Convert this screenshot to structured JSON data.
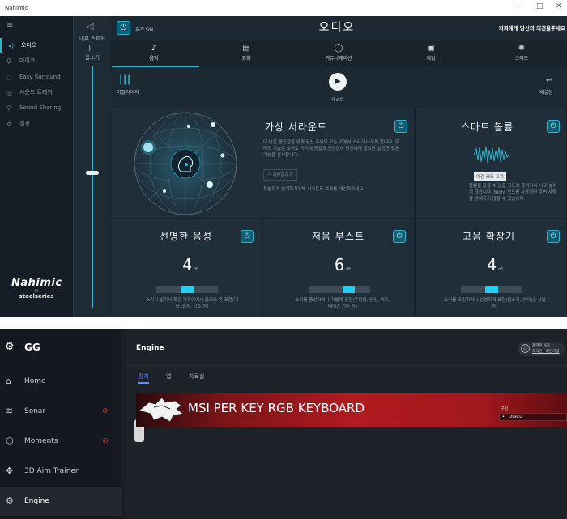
{
  "nahimic": {
    "window_title": "Nahimic",
    "window_controls": [
      "—",
      "□",
      "✕"
    ],
    "sidebar": {
      "items": [
        {
          "label": "오디오",
          "icon": "speaker-icon"
        },
        {
          "label": "마이크",
          "icon": "mic-icon"
        },
        {
          "label": "Easy Surround",
          "icon": "surround-icon"
        },
        {
          "label": "사운드 트래커",
          "icon": "tracker-icon"
        },
        {
          "label": "Sound Sharing",
          "icon": "share-icon"
        },
        {
          "label": "설정",
          "icon": "gear-icon"
        }
      ],
      "logo_brand": "Nahimic",
      "logo_by": "BY",
      "logo_partner": "steelseries"
    },
    "volume": {
      "device_label": "내부 스피커",
      "volume_label": "음소거",
      "level": 0.56
    },
    "header": {
      "effect_label": "효과 ON",
      "title": "오디오",
      "feedback_link": "저희에게 당신의 의견을주세요"
    },
    "tabs": [
      {
        "label": "음악",
        "icon": "music-note-icon",
        "active": true
      },
      {
        "label": "영화",
        "icon": "clapper-icon",
        "active": false
      },
      {
        "label": "커뮤니케이션",
        "icon": "chat-icon",
        "active": false
      },
      {
        "label": "게임",
        "icon": "gamepad-icon",
        "active": false
      },
      {
        "label": "스마트",
        "icon": "smart-icon",
        "active": false
      }
    ],
    "toolbar": {
      "equalizer_label": "이퀄라이저",
      "test_label": "테스트",
      "reset_label": "재설정"
    },
    "panels": {
      "virtual_surround": {
        "title": "가상 서라운드",
        "description": "더 나은 몰입감을 위해 당신 주위의 모든 곳에서 소리가 나도록 합니다. 우리의 기술은 오디오 기기에 동일과 신관없이 당신에게 필요한 설정한 모든 기능을 선사합니다.",
        "personalize_label": "개인화하기",
        "note": "특별하게 설계하기위해 서라운드 효과를 개인화하세요"
      },
      "smart_volume": {
        "title": "스마트 볼륨",
        "mode_label": "야간 모드 끄기",
        "description": "볼륨을 들을 수 없을 정도로 줄이거나 너무 높여지 않습니다. Night 모드를 사용하면 주변 사람을 방해하지 않을 수 있습니다."
      },
      "voice_clarity": {
        "title": "선명한 음성",
        "value": "4",
        "unit": "dB",
        "level": 0.5,
        "description": "소리가 빌리서 혹은 가까이에서 들려도 목 표현(대화, 협정, 답소 등)"
      },
      "bass_boost": {
        "title": "저음 부스트",
        "value": "6",
        "unit": "dB",
        "level": 0.65,
        "description": "소리를 풍성하거나 가볍게 표현(우렁음, 엔진, 비트, 베이스 기타 등)"
      },
      "treble_boost": {
        "title": "고음 확장기",
        "value": "4",
        "unit": "dB",
        "level": 0.5,
        "description": "소리를 조밀하거나 선명하게 표현(발소리, 위타닝, 심벌 등)"
      }
    }
  },
  "gg": {
    "app_title": "GG",
    "sidebar": {
      "items": [
        {
          "label": "Home",
          "icon": "home-icon",
          "active": false,
          "disabled_icon": ""
        },
        {
          "label": "Sonar",
          "icon": "sonar-icon",
          "active": false,
          "disabled_icon": "headset-off-icon"
        },
        {
          "label": "Moments",
          "icon": "moments-icon",
          "active": false,
          "disabled_icon": "capture-off-icon"
        },
        {
          "label": "3D Aim Trainer",
          "icon": "crosshair-icon",
          "active": false,
          "disabled_icon": ""
        },
        {
          "label": "Engine",
          "icon": "gear-icon",
          "active": true,
          "disabled_icon": ""
        }
      ]
    },
    "header": {
      "title": "Engine",
      "user_name": "제한된 사용",
      "user_link": "로그인 | 회원가입"
    },
    "tabs": [
      {
        "label": "장치",
        "active": true
      },
      {
        "label": "앱",
        "active": false
      },
      {
        "label": "자료실",
        "active": false
      }
    ],
    "device": {
      "name": "MSI PER KEY RGB KEYBOARD",
      "config_label": "구성",
      "config_value": "DISCO"
    }
  }
}
